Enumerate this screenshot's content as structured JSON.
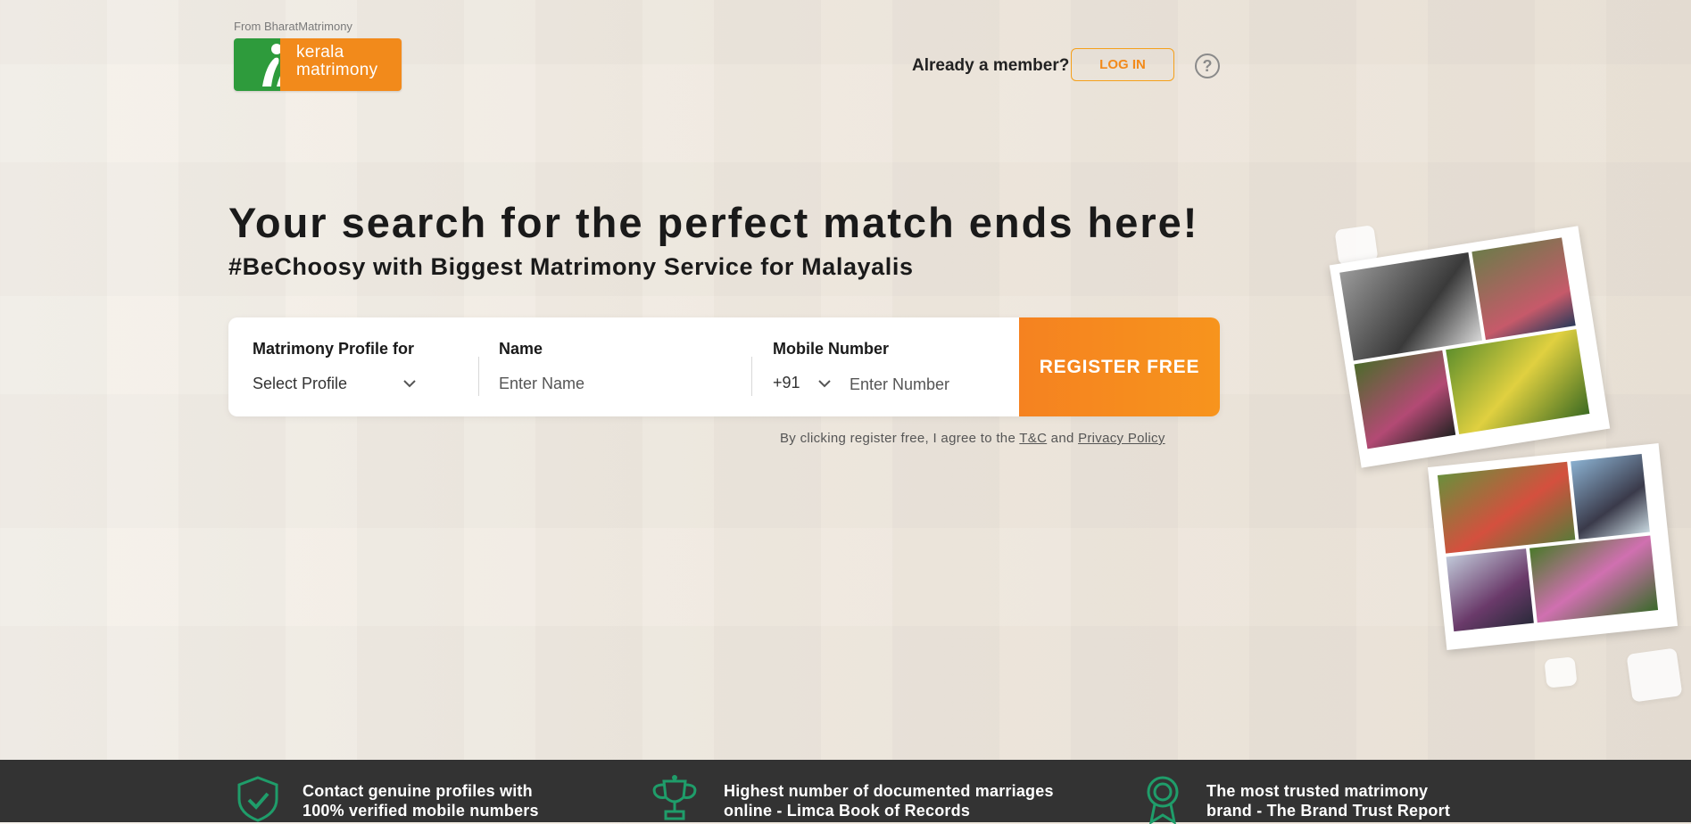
{
  "header": {
    "from_text": "From BharatMatrimony",
    "logo": {
      "line1": "kerala",
      "line2": "matrimony"
    },
    "already_member": "Already a member?",
    "login_label": "LOG IN",
    "help_icon": "question-icon",
    "help_glyph": "?"
  },
  "hero": {
    "headline": "Your search for the perfect match ends here!",
    "subheadline": "#BeChoosy with Biggest Matrimony Service for Malayalis"
  },
  "form": {
    "profile_label": "Matrimony Profile for",
    "profile_value": "Select Profile",
    "name_label": "Name",
    "name_placeholder": "Enter Name",
    "mobile_label": "Mobile Number",
    "country_code": "+91",
    "mobile_placeholder": "Enter Number",
    "register_label": "REGISTER FREE"
  },
  "terms": {
    "prefix": "By clicking register free, I agree to the",
    "tc_link": "T&C",
    "and": "and",
    "privacy_link": "Privacy Policy"
  },
  "features": [
    {
      "icon": "shield-check-icon",
      "line1": "Contact genuine profiles with",
      "line2": "100% verified mobile numbers"
    },
    {
      "icon": "trophy-icon",
      "line1": "Highest number of documented marriages",
      "line2": "online - Limca Book of Records"
    },
    {
      "icon": "award-badge-icon",
      "line1": "The most trusted matrimony",
      "line2": "brand - The Brand Trust Report"
    }
  ],
  "colors": {
    "accent": "#f58220",
    "green": "#2e9b3c",
    "footer_bg": "#333333",
    "icon_green": "#1f9d6a"
  }
}
